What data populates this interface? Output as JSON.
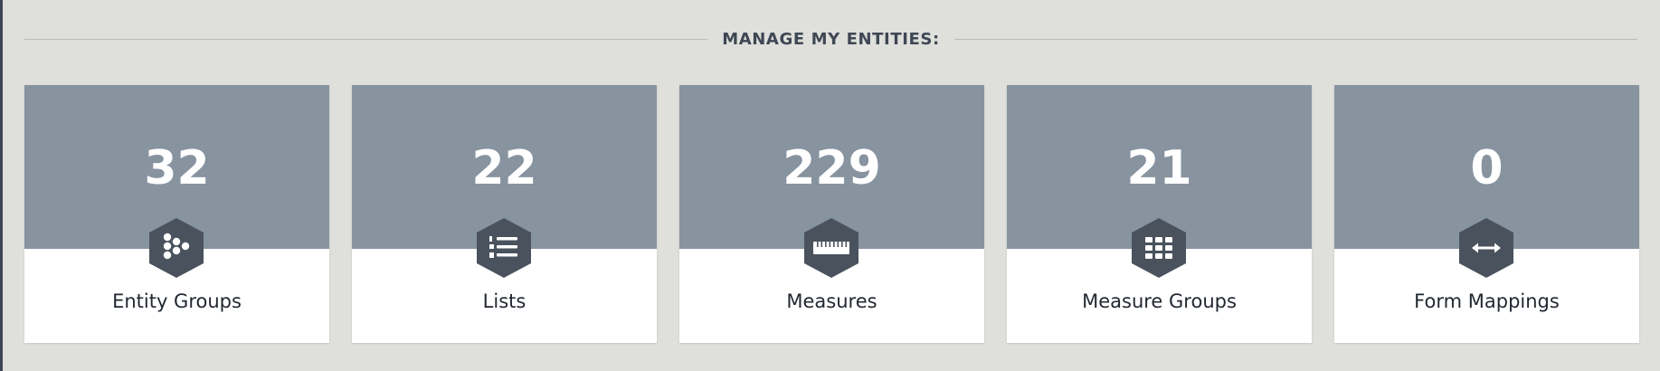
{
  "section": {
    "title": "MANAGE MY ENTITIES:"
  },
  "colors": {
    "background": "#dfdfdb",
    "card_top": "#8893a0",
    "icon_hex": "#4a525d",
    "text_dark": "#222831"
  },
  "cards": [
    {
      "count": "32",
      "label": "Entity Groups",
      "icon": "entity-groups-icon"
    },
    {
      "count": "22",
      "label": "Lists",
      "icon": "numbered-list-icon"
    },
    {
      "count": "229",
      "label": "Measures",
      "icon": "ruler-icon"
    },
    {
      "count": "21",
      "label": "Measure Groups",
      "icon": "grid-icon"
    },
    {
      "count": "0",
      "label": "Form Mappings",
      "icon": "double-arrow-icon"
    }
  ]
}
